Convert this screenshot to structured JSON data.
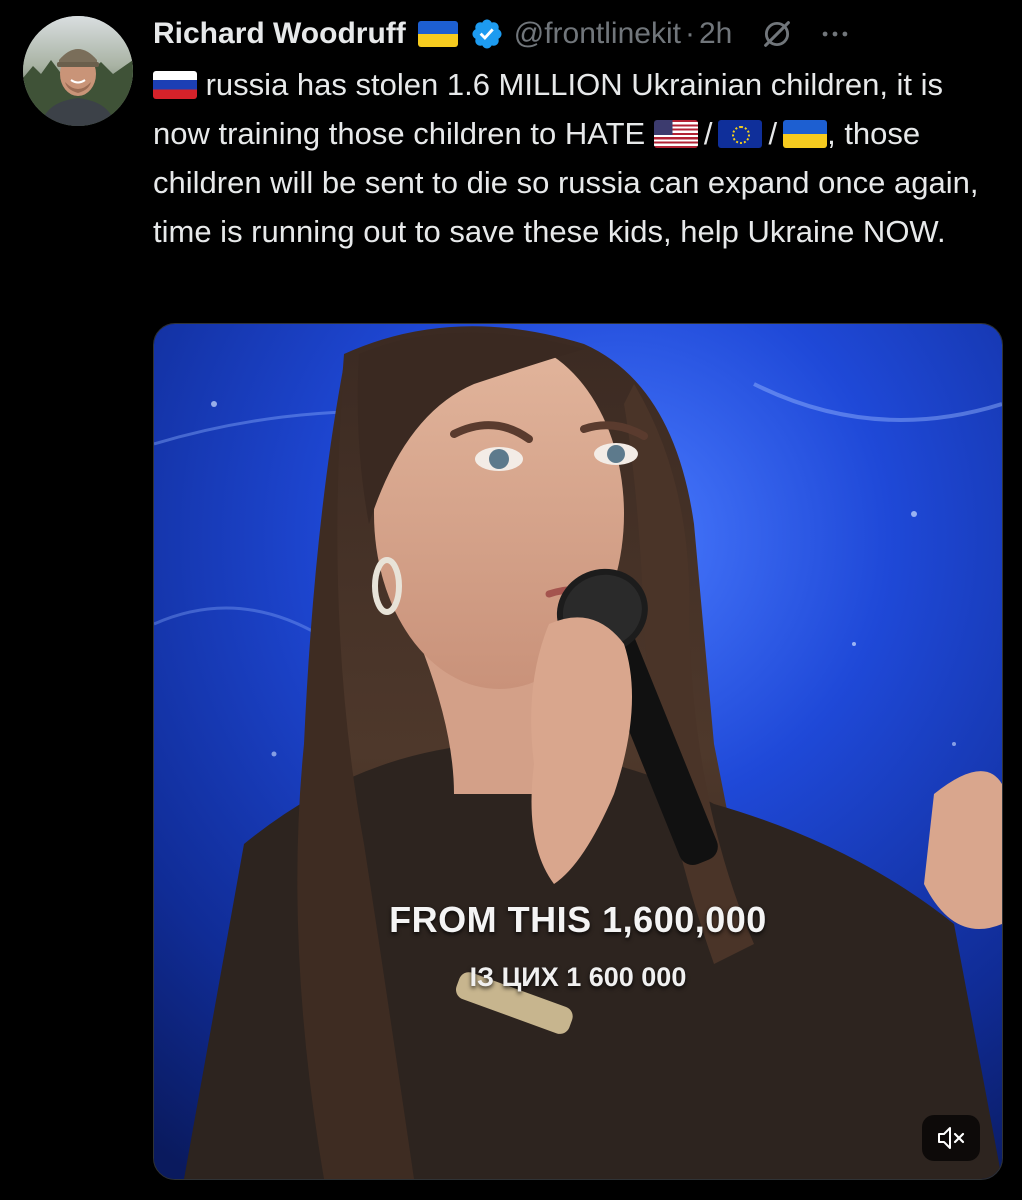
{
  "author": {
    "name": "Richard Woodruff",
    "name_flag_icon": "ukraine-flag-icon",
    "verified_icon": "verified-badge-icon",
    "handle": "@frontlinekit",
    "separator": "·",
    "time": "2h"
  },
  "header_icons": {
    "grok": "grok-icon",
    "more": "more-options-icon"
  },
  "tweet": {
    "lead_flag_icon": "russia-flag-icon",
    "text_part1": " russia has stolen 1.6 MILLION Ukrainian children, it is now training those children to HATE ",
    "flag_icons": [
      "usa-flag-icon",
      "eu-flag-icon",
      "ukraine-flag-icon"
    ],
    "slash": "/",
    "text_part2": ", those children will be sent to die so russia can expand once again, time is running out to save these kids, help Ukraine NOW."
  },
  "media": {
    "type": "video",
    "caption_main": "FROM THIS 1,600,000",
    "caption_sub": "ІЗ ЦИХ 1 600 000",
    "mute_icon": "volume-muted-icon"
  },
  "colors": {
    "background": "#000000",
    "text": "#e7e9ea",
    "muted_text": "#71767b",
    "verified_blue": "#1d9bf0"
  }
}
